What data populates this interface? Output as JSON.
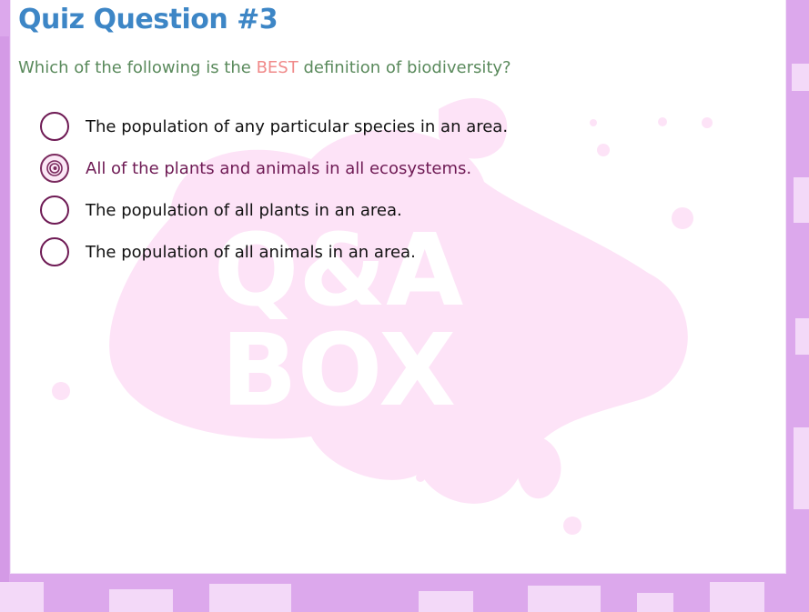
{
  "quiz": {
    "title": "Quiz Question #3",
    "question_prefix": "Which of the following is the ",
    "question_emphasis": "BEST",
    "question_suffix": " definition of biodiversity?",
    "watermark_lines": [
      "Q&A",
      "BOX"
    ],
    "options": [
      {
        "label": "The population of any particular species in an area.",
        "selected": false
      },
      {
        "label": "All of the plants and animals in all ecosystems.",
        "selected": true
      },
      {
        "label": "The population of all plants in an area.",
        "selected": false
      },
      {
        "label": "The population of all animals in an area.",
        "selected": false
      }
    ]
  },
  "colors": {
    "title": "#3d86c6",
    "question": "#5a8a5c",
    "emphasis": "#f08a8a",
    "radio_border": "#6e1a54",
    "selected_text": "#6e1a54",
    "frame": "#dca8ec",
    "watermark": "#fde3f7"
  }
}
